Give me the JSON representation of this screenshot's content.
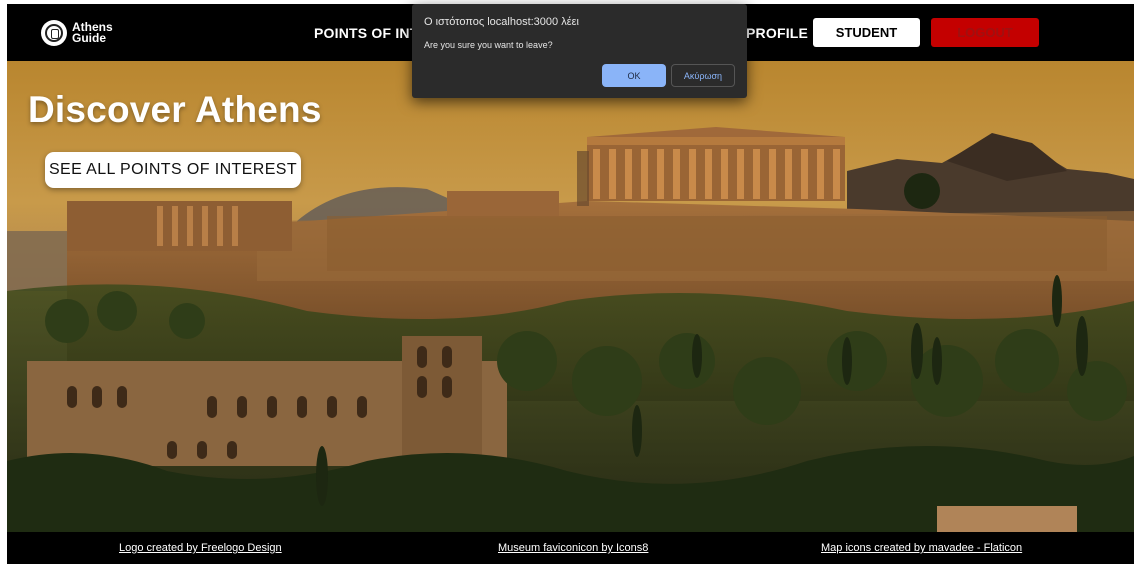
{
  "header": {
    "logo_line1": "Athens",
    "logo_line2": "Guide",
    "nav_points_of_interest": "POINTS OF INTEREST",
    "nav_profile": "PROFILE",
    "student_button": "STUDENT",
    "logout_button": "LOGOUT"
  },
  "hero": {
    "title": "Discover Athens",
    "button": "SEE ALL POINTS OF INTEREST"
  },
  "footer": {
    "links": [
      "Logo created by Freelogo Design",
      "Museum faviconicon by Icons8",
      "Map icons created by mavadee - Flaticon"
    ]
  },
  "dialog": {
    "title": "Ο ιστότοπος localhost:3000 λέει",
    "message": "Are you sure you want to leave?",
    "ok": "OK",
    "cancel": "Ακύρωση"
  },
  "colors": {
    "header_bg": "#000000",
    "logout_bg": "#c40000",
    "dialog_bg": "#2b2b2b",
    "dialog_accent": "#8ab4f8"
  },
  "icons": [
    "athens-guide-logo-icon"
  ]
}
